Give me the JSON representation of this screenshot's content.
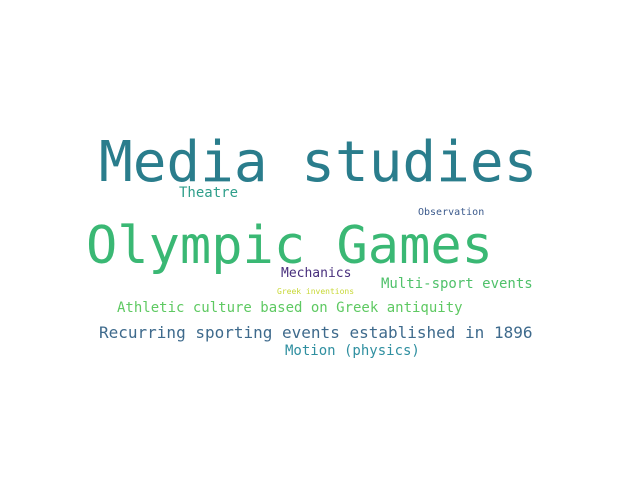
{
  "word_cloud": {
    "words": [
      {
        "text": "Media studies",
        "color": "#2a7d8c"
      },
      {
        "text": "Olympic Games",
        "color": "#3ab874"
      },
      {
        "text": "Theatre",
        "color": "#2e9e8a"
      },
      {
        "text": "Observation",
        "color": "#3b5a8c"
      },
      {
        "text": "Mechanics",
        "color": "#472e7c"
      },
      {
        "text": "Multi-sport events",
        "color": "#4fc16a"
      },
      {
        "text": "Greek inventions",
        "color": "#c8d836"
      },
      {
        "text": "Athletic culture based on Greek antiquity",
        "color": "#5ec962"
      },
      {
        "text": "Recurring sporting events established in 1896",
        "color": "#3e6a8c"
      },
      {
        "text": "Motion (physics)",
        "color": "#2f8fa0"
      }
    ]
  }
}
